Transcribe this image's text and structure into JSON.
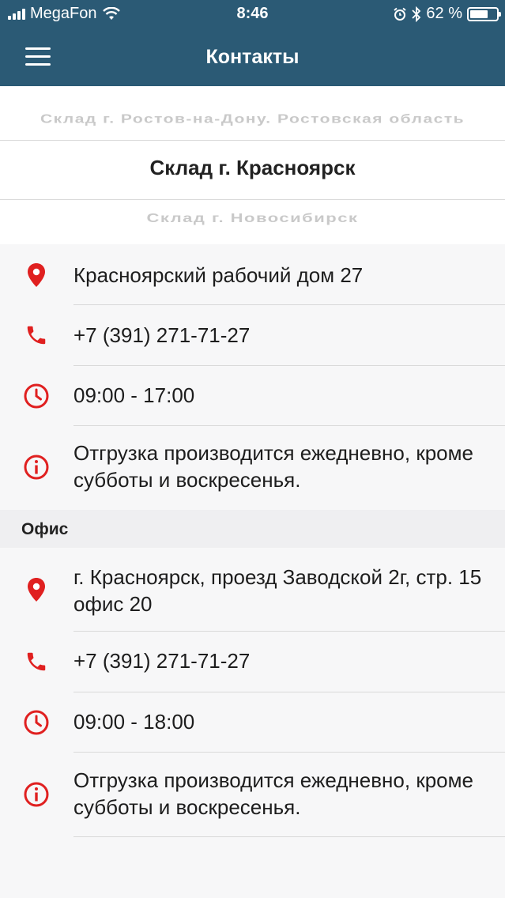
{
  "status_bar": {
    "carrier": "MegaFon",
    "time": "8:46",
    "battery": "62 %"
  },
  "header": {
    "title": "Контакты"
  },
  "picker": {
    "prev": "Склад г. Ростов-на-Дону.  Ростовская область",
    "selected": "Склад г. Красноярск",
    "next": "Склад г. Новосибирск"
  },
  "warehouse": {
    "address": "Красноярский рабочий дом 27",
    "phone": "+7 (391) 271-71-27",
    "hours": "09:00 - 17:00",
    "info": "Отгрузка производится ежедневно, кроме субботы и воскресенья."
  },
  "office": {
    "section_title": "Офис",
    "address": "г. Красноярск, проезд Заводской 2г, стр. 15 офис 20",
    "phone": "+7 (391) 271-71-27",
    "hours": "09:00 - 18:00",
    "info": "Отгрузка производится ежедневно, кроме субботы и воскресенья."
  },
  "colors": {
    "header_bg": "#2b5a75",
    "icon_red": "#e02020"
  },
  "icons": {
    "address": "location-pin-icon",
    "phone": "phone-icon",
    "hours": "clock-icon",
    "info": "info-icon",
    "menu": "hamburger-menu-icon"
  }
}
